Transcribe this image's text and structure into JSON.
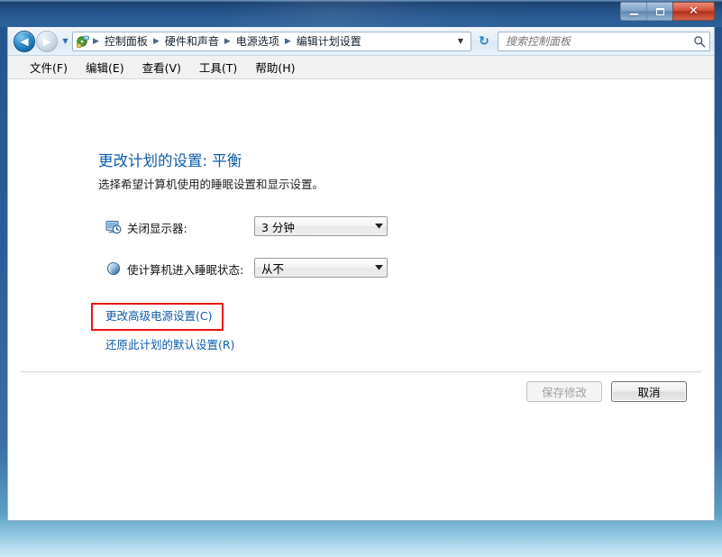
{
  "window": {
    "caption_buttons": [
      {
        "name": "minimize",
        "glyph": "minimize-icon"
      },
      {
        "name": "maximize",
        "glyph": "maximize-icon"
      },
      {
        "name": "close",
        "glyph": "✕"
      }
    ]
  },
  "nav": {
    "back_glyph": "◀",
    "forward_glyph": "▶",
    "history_glyph": "▼",
    "refresh_glyph": "↻",
    "breadcrumb": [
      "控制面板",
      "硬件和声音",
      "电源选项",
      "编辑计划设置"
    ],
    "breadcrumb_separator": "▶",
    "breadcrumb_dropdown_glyph": "▼"
  },
  "search": {
    "placeholder": "搜索控制面板",
    "value": "",
    "icon": "search-icon"
  },
  "menu": {
    "items": [
      "文件(F)",
      "编辑(E)",
      "查看(V)",
      "工具(T)",
      "帮助(H)"
    ]
  },
  "page": {
    "title": "更改计划的设置: 平衡",
    "subtitle": "选择希望计算机使用的睡眠设置和显示设置。"
  },
  "settings": [
    {
      "icon": "monitor-clock-icon",
      "label": "关闭显示器:",
      "value": "3 分钟",
      "arrow_glyph": "▼"
    },
    {
      "icon": "moon-sleep-icon",
      "label": "使计算机进入睡眠状态:",
      "value": "从不",
      "arrow_glyph": "▼"
    }
  ],
  "links": {
    "advanced": "更改高级电源设置(C)",
    "restore": "还原此计划的默认设置(R)"
  },
  "buttons": {
    "save": {
      "label": "保存修改",
      "enabled": false
    },
    "cancel": {
      "label": "取消",
      "enabled": true
    }
  },
  "colors": {
    "link": "#0d5cab",
    "title": "#0d5cab",
    "highlight": "#ee1111",
    "titlebar": "#24548a",
    "close_button": "#b32f1b"
  }
}
